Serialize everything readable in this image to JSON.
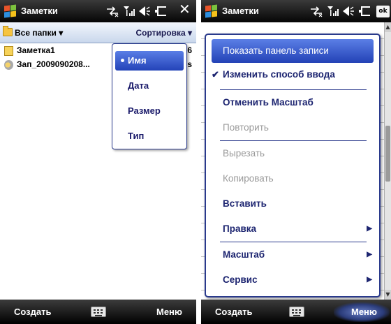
{
  "left": {
    "title": "Заметки",
    "close_glyph": "✕",
    "folder_label": "Все папки ▾",
    "sort_label": "Сортировка ▾",
    "rows": [
      {
        "name": "Заметка1",
        "meta": "6"
      },
      {
        "name": "Зап_2009090208...",
        "meta": "1s"
      }
    ],
    "sort_menu": {
      "items": [
        "Имя",
        "Дата",
        "Размер",
        "Тип"
      ],
      "selected": "Имя"
    },
    "softkeys": {
      "left": "Создать",
      "right": "Меню"
    }
  },
  "right": {
    "title": "Заметки",
    "ok_label": "ok",
    "menu": {
      "show_panel": "Показать панель записи",
      "change_input": "Изменить способ ввода",
      "cancel_zoom": "Отменить Масштаб",
      "redo": "Повторить",
      "cut": "Вырезать",
      "copy": "Копировать",
      "paste": "Вставить",
      "edit": "Правка",
      "zoom": "Масштаб",
      "tools": "Сервис"
    },
    "softkeys": {
      "left": "Создать",
      "right": "Меню"
    }
  },
  "icons": {
    "windows_logo": "windows-logo-icon",
    "connectivity": "connectivity-icon",
    "signal": "signal-icon",
    "volume": "volume-icon",
    "battery": "battery-icon",
    "keyboard": "keyboard-icon",
    "check": "✔",
    "submenu_arrow": "▶"
  },
  "colors": {
    "title_bar": "#0a0a0a",
    "menu_border": "#2a3a8c",
    "menu_text": "#1c2470",
    "selection": "#2d4fc6",
    "disabled_text": "#9a9a9a"
  }
}
